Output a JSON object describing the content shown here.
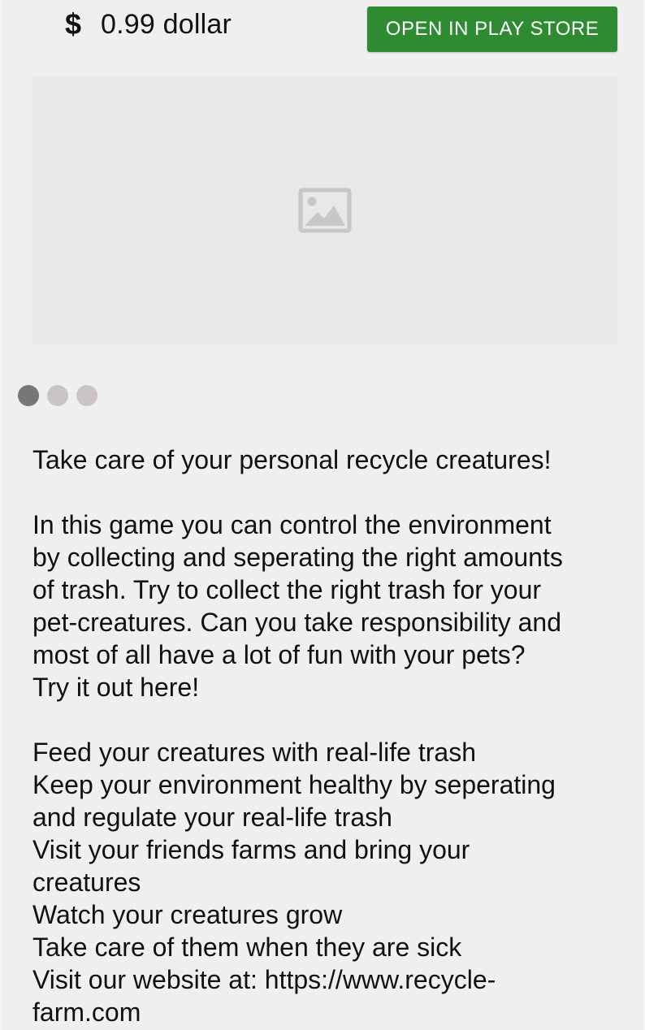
{
  "header": {
    "price_icon": "dollar-icon",
    "price_text": "0.99 dollar",
    "play_store_button_label": "OPEN IN PLAY STORE",
    "button_color": "#2e8b32"
  },
  "media": {
    "placeholder_icon": "image-placeholder-icon"
  },
  "carousel": {
    "dot_count": 3,
    "active_index": 0
  },
  "description": {
    "lines": [
      "Take care of your personal recycle creatures!",
      "",
      "In this game you can control the environment",
      "by collecting and seperating the right amounts",
      "of trash. Try to collect the right trash for your",
      "pet-creatures. Can you take responsibility and",
      "most of all have a lot of fun with your pets?",
      "Try it out here!",
      "",
      "Feed your creatures with real-life trash",
      "Keep your environment healthy by seperating",
      "and regulate your real-life trash",
      "Visit your friends farms and bring your",
      "creatures",
      "Watch your creatures grow",
      "Take care of them when they are sick",
      "Visit our website at: https://www.recycle-",
      "farm.com"
    ]
  }
}
